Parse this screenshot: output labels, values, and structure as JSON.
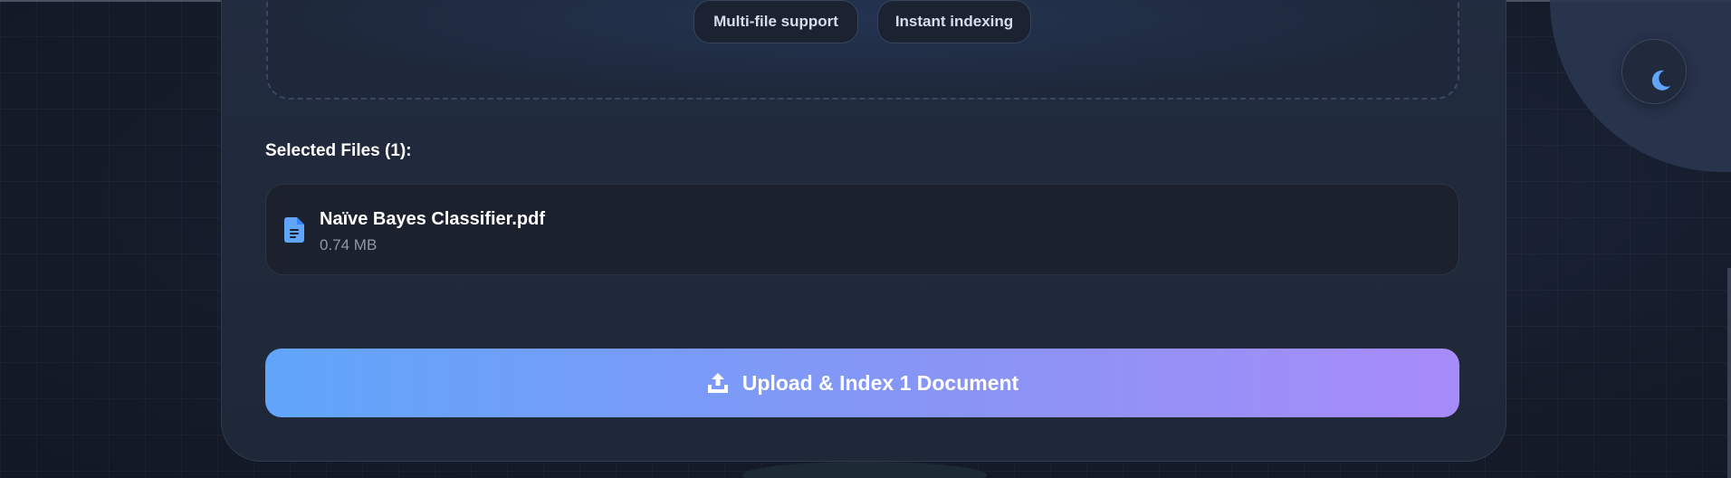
{
  "dropzone": {
    "features": [
      "Multi-file support",
      "Instant indexing"
    ]
  },
  "selected_files": {
    "title": "Selected Files (1):",
    "files": [
      {
        "name": "Naïve Bayes Classifier.pdf",
        "size": "0.74 MB",
        "icon": "document-icon"
      }
    ]
  },
  "upload_button": {
    "label": "Upload & Index 1 Document",
    "icon": "upload-icon"
  },
  "theme_toggle": {
    "icon": "moon-icon"
  },
  "colors": {
    "accent_start": "#60a5fa",
    "accent_end": "#a78bfa",
    "icon_blue": "#60a5fa"
  }
}
